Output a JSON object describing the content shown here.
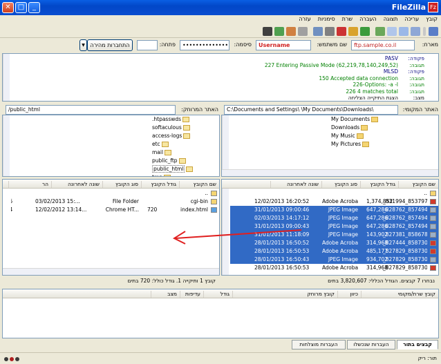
{
  "window": {
    "title": "FileZilla",
    "app_icon_label": "Fz"
  },
  "menu": [
    "קובץ",
    "עריכה",
    "תצוגה",
    "העברה",
    "שרת",
    "סימניות",
    "עזרה"
  ],
  "quickconnect": {
    "host_label": "מארח:",
    "host_value": "ftp.sample.co.il",
    "user_label": "שם משתמש:",
    "user_value": "Username",
    "pass_label": "סיסמה:",
    "pass_value": "••••••••••••••",
    "port_label": "פתחה:",
    "port_value": "",
    "connect_label": "התחברות מהירה",
    "dropdown_glyph": "▼"
  },
  "log": [
    {
      "k": "פקודה:",
      "v": "PASV",
      "color": "#000080"
    },
    {
      "k": "תגובה:",
      "v": "227 Entering Passive Mode (62,219,78,140,249,52)",
      "color": "#008000"
    },
    {
      "k": "פקודה:",
      "v": "MLSD",
      "color": "#000080"
    },
    {
      "k": "תגובה:",
      "v": "150 Accepted data connection",
      "color": "#008000"
    },
    {
      "k": "תגובה:",
      "v": "226-Options: -a -l",
      "color": "#008000"
    },
    {
      "k": "תגובה:",
      "v": "226 4 matches total",
      "color": "#008000"
    },
    {
      "k": "מצב:",
      "v": "הצגת התיקייה הצליחה",
      "color": "#000000"
    }
  ],
  "remote": {
    "path_label": "האתר המרוחק:",
    "path_value": "/public_html",
    "tree": [
      ".htpasswds",
      "softaculous",
      "access-logs",
      "etc",
      "mail",
      "public_ftp",
      "public_html",
      "tmp"
    ],
    "headers": {
      "name": "שם הקובץ",
      "size": "גודל הקובץ",
      "type": "סוג הקובץ",
      "modified": "שונה לאחרונה",
      "perm": "הר"
    },
    "files": [
      {
        "name": "..",
        "size": "",
        "type": "",
        "modified": "",
        "perm": ""
      },
      {
        "name": "cgi-bin",
        "size": "",
        "type": "File Folder",
        "modified": "03/02/2013 15:...",
        "perm": "755"
      },
      {
        "name": "index.html",
        "size": "720",
        "type": "Chrome HT...",
        "modified": "12/02/2012 13:14...",
        "perm": "644"
      }
    ],
    "status": "קובץ 1 ותיקייה 1. גודל כולל: 720 בתים"
  },
  "local": {
    "path_label": "האתר המקומי:",
    "path_value": "C:\\Documents and Settings\\         \\My Documents\\Downloads\\",
    "tree": [
      "My Documents",
      "Downloads",
      "My Music",
      "My Pictures"
    ],
    "headers": {
      "name": "שם הקובץ",
      "size": "גודל הקובץ",
      "type": "סוג הקובץ",
      "modified": "שונה לאחרונה"
    },
    "files": [
      {
        "name": "..",
        "size": "",
        "type": "",
        "modified": "",
        "sel": false
      },
      {
        "name": "_831994_853797...",
        "size": "1,374,852",
        "type": "Adobe Acrobat",
        "modified": "12/02/2013 16:20:52",
        "sel": false
      },
      {
        "name": "_828762_857494...",
        "size": "647,286",
        "type": "JPEG Image",
        "modified": "31/01/2013 09:00:46",
        "sel": true
      },
      {
        "name": "_828762_857494...",
        "size": "647,286",
        "type": "JPEG Image",
        "modified": "02/03/2013 14:17:12",
        "sel": true
      },
      {
        "name": "_828762_857494...",
        "size": "647,286",
        "type": "JPEG Image",
        "modified": "31/01/2013 09:00:43",
        "sel": true
      },
      {
        "name": "_827381_858678...",
        "size": "143,902",
        "type": "JPEG Image",
        "modified": "31/01/2013 11:18:09",
        "sel": true
      },
      {
        "name": "_827444_858730...",
        "size": "314,968",
        "type": "Adobe Acrobat",
        "modified": "28/01/2013 16:50:52",
        "sel": true
      },
      {
        "name": "_827829_858730...",
        "size": "485,177",
        "type": "Adobe Acrobat",
        "modified": "28/01/2013 16:50:53",
        "sel": true
      },
      {
        "name": "_827829_858730...",
        "size": "934,702",
        "type": "JPEG Image",
        "modified": "28/01/2013 16:50:43",
        "sel": true
      },
      {
        "name": "_827829_858730...",
        "size": "314,968",
        "type": "Adobe Acrobat",
        "modified": "28/01/2013 16:50:53",
        "sel": false
      }
    ],
    "status": "נבחרו 7 קבצים. הגודל הכללי: 3,820,607 בתים"
  },
  "queue": {
    "headers": {
      "server": "קובץ שרת/מקומי",
      "dir": "כיוון",
      "remote": "קובץ מרוחק",
      "size": "גודל",
      "priority": "עדיפות",
      "status": "מצב"
    }
  },
  "queue_tabs": {
    "queued": "קבצים בתור",
    "failed": "העברות שנכשלו",
    "successful": "העברות מוצלחות"
  },
  "statusbar": {
    "queue": "תור: ריק"
  },
  "colors": {
    "selection": "#316ac5",
    "titlebar": "#0a5fe3",
    "arrow": "#e02020"
  }
}
